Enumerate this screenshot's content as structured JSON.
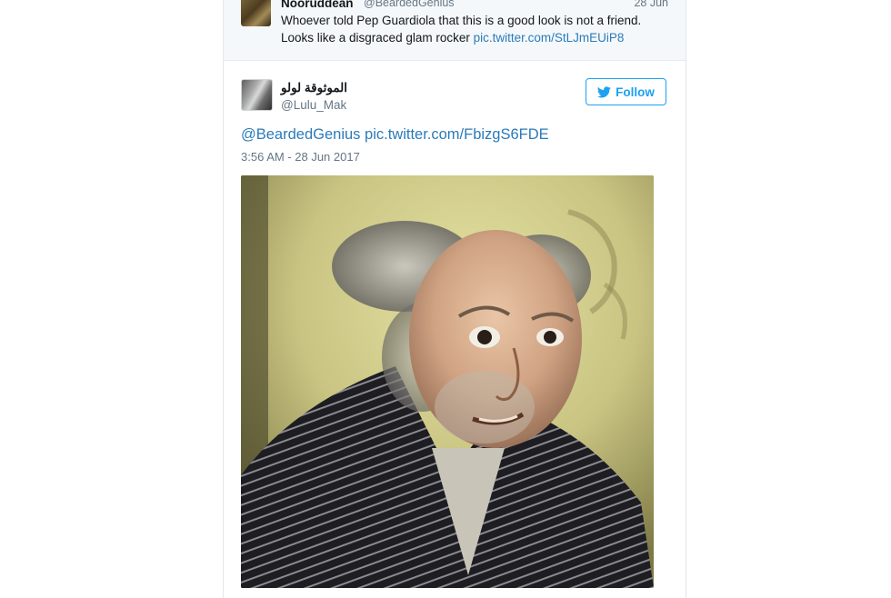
{
  "quoted_tweet": {
    "name": "Nooruddean",
    "handle": "@BeardedGenius",
    "date": "28 Jun",
    "text_line1": "Whoever told Pep Guardiola that this is a good look is not a friend.",
    "text_line2": "Looks like a disgraced glam rocker ",
    "link": "pic.twitter.com/StLJmEUiP8"
  },
  "tweet": {
    "author_name": "الموثوقة لولو",
    "author_handle": "@Lulu_Mak",
    "follow_label": "Follow",
    "text_mention": "@BeardedGenius",
    "text_link": "pic.twitter.com/FbizgS6FDE",
    "timestamp": "3:56 AM - 28 Jun 2017"
  },
  "colors": {
    "link": "#2b7bb9",
    "twitter_blue": "#1da1f2",
    "muted": "#657786"
  },
  "icons": {
    "follow": "twitter-bird-icon"
  }
}
